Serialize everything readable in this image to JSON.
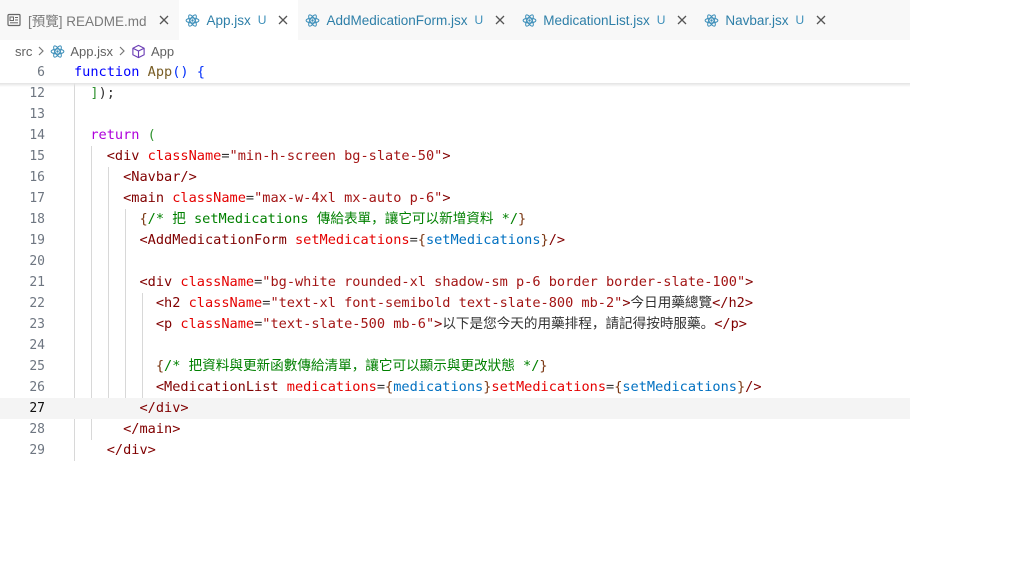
{
  "tabs": [
    {
      "icon": "preview-icon",
      "label": "[預覽] README.md",
      "modified": "",
      "active": false
    },
    {
      "icon": "react-icon",
      "label": "App.jsx",
      "modified": "U",
      "active": true
    },
    {
      "icon": "react-icon",
      "label": "AddMedicationForm.jsx",
      "modified": "U",
      "active": false
    },
    {
      "icon": "react-icon",
      "label": "MedicationList.jsx",
      "modified": "U",
      "active": false
    },
    {
      "icon": "react-icon",
      "label": "Navbar.jsx",
      "modified": "U",
      "active": false
    }
  ],
  "breadcrumb": {
    "folder": "src",
    "file": "App.jsx",
    "symbol": "App"
  },
  "editor": {
    "current_line": "27",
    "lines": [
      {
        "n": "6",
        "tokens": [
          [
            "t-kw",
            "function "
          ],
          [
            "t-fn",
            "App"
          ],
          [
            "t-br1",
            "() {"
          ]
        ]
      },
      {
        "n": "12",
        "tokens": [
          [
            "t-br2",
            "  ]"
          ],
          [
            "t-plain",
            ");"
          ]
        ]
      },
      {
        "n": "13",
        "tokens": []
      },
      {
        "n": "14",
        "tokens": [
          [
            "t-ctl",
            "  return "
          ],
          [
            "t-br2",
            "("
          ]
        ]
      },
      {
        "n": "15",
        "tokens": [
          [
            "t-tag",
            "    <div "
          ],
          [
            "t-attr",
            "className"
          ],
          [
            "t-plain",
            "="
          ],
          [
            "t-str",
            "\"min-h-screen bg-slate-50\""
          ],
          [
            "t-tag",
            ">"
          ]
        ]
      },
      {
        "n": "16",
        "tokens": [
          [
            "t-tag",
            "      <Navbar/>"
          ]
        ]
      },
      {
        "n": "17",
        "tokens": [
          [
            "t-tag",
            "      <main "
          ],
          [
            "t-attr",
            "className"
          ],
          [
            "t-plain",
            "="
          ],
          [
            "t-str",
            "\"max-w-4xl mx-auto p-6\""
          ],
          [
            "t-tag",
            ">"
          ]
        ]
      },
      {
        "n": "18",
        "tokens": [
          [
            "t-br3",
            "        {"
          ],
          [
            "t-cmt",
            "/* 把 setMedications 傳給表單，讓它可以新增資料 */"
          ],
          [
            "t-br3",
            "}"
          ]
        ]
      },
      {
        "n": "19",
        "tokens": [
          [
            "t-tag",
            "        <AddMedicationForm "
          ],
          [
            "t-attr",
            "setMedications"
          ],
          [
            "t-plain",
            "="
          ],
          [
            "t-br3",
            "{"
          ],
          [
            "t-var",
            "setMedications"
          ],
          [
            "t-br3",
            "}"
          ],
          [
            "t-tag",
            "/>"
          ]
        ]
      },
      {
        "n": "20",
        "tokens": []
      },
      {
        "n": "21",
        "tokens": [
          [
            "t-tag",
            "        <div "
          ],
          [
            "t-attr",
            "className"
          ],
          [
            "t-plain",
            "="
          ],
          [
            "t-str",
            "\"bg-white rounded-xl shadow-sm p-6 border border-slate-100\""
          ],
          [
            "t-tag",
            ">"
          ]
        ]
      },
      {
        "n": "22",
        "tokens": [
          [
            "t-tag",
            "          <h2 "
          ],
          [
            "t-attr",
            "className"
          ],
          [
            "t-plain",
            "="
          ],
          [
            "t-str",
            "\"text-xl font-semibold text-slate-800 mb-2\""
          ],
          [
            "t-tag",
            ">"
          ],
          [
            "t-plain",
            "今日用藥總覽"
          ],
          [
            "t-tag",
            "</h2>"
          ]
        ]
      },
      {
        "n": "23",
        "tokens": [
          [
            "t-tag",
            "          <p "
          ],
          [
            "t-attr",
            "className"
          ],
          [
            "t-plain",
            "="
          ],
          [
            "t-str",
            "\"text-slate-500 mb-6\""
          ],
          [
            "t-tag",
            ">"
          ],
          [
            "t-plain",
            "以下是您今天的用藥排程，請記得按時服藥。"
          ],
          [
            "t-tag",
            "</p>"
          ]
        ]
      },
      {
        "n": "24",
        "tokens": []
      },
      {
        "n": "25",
        "tokens": [
          [
            "t-br3",
            "          {"
          ],
          [
            "t-cmt",
            "/* 把資料與更新函數傳給清單，讓它可以顯示與更改狀態 */"
          ],
          [
            "t-br3",
            "}"
          ]
        ]
      },
      {
        "n": "26",
        "tokens": [
          [
            "t-tag",
            "          <MedicationList "
          ],
          [
            "t-attr",
            "medications"
          ],
          [
            "t-plain",
            "="
          ],
          [
            "t-br3",
            "{"
          ],
          [
            "t-var",
            "medications"
          ],
          [
            "t-br3",
            "}"
          ],
          [
            "t-attr",
            "setMedications"
          ],
          [
            "t-plain",
            "="
          ],
          [
            "t-br3",
            "{"
          ],
          [
            "t-var",
            "setMedications"
          ],
          [
            "t-br3",
            "}"
          ],
          [
            "t-tag",
            "/>"
          ]
        ]
      },
      {
        "n": "27",
        "tokens": [
          [
            "t-tag",
            "        </div>"
          ]
        ]
      },
      {
        "n": "28",
        "tokens": [
          [
            "t-tag",
            "      </main>"
          ]
        ]
      },
      {
        "n": "29",
        "tokens": [
          [
            "t-tag",
            "    </div>"
          ]
        ]
      }
    ]
  }
}
